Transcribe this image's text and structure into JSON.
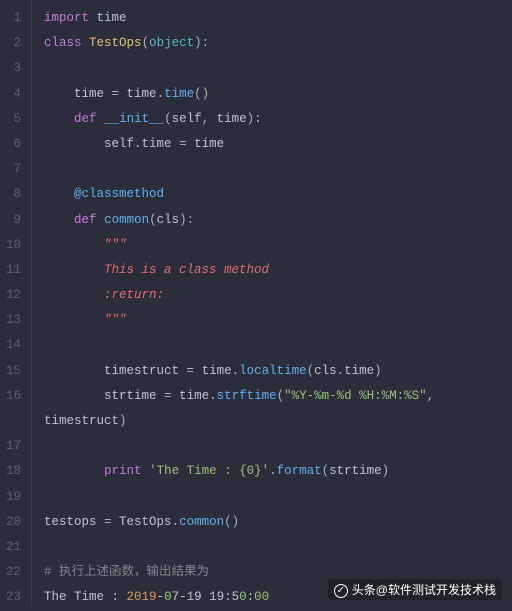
{
  "lineCount": 23,
  "lines": [
    [
      [
        "kw",
        "import"
      ],
      [
        "nm",
        " time"
      ]
    ],
    [
      [
        "kw",
        "class"
      ],
      [
        "nm",
        " "
      ],
      [
        "cls",
        "TestOps"
      ],
      [
        "pun",
        "("
      ],
      [
        "bi",
        "object"
      ],
      [
        "pun",
        "):"
      ]
    ],
    [],
    [
      [
        "nm",
        "    time "
      ],
      [
        "pun",
        "="
      ],
      [
        "nm",
        " time"
      ],
      [
        "pun",
        "."
      ],
      [
        "fn",
        "time"
      ],
      [
        "pun",
        "()"
      ]
    ],
    [
      [
        "nm",
        "    "
      ],
      [
        "kw",
        "def"
      ],
      [
        "nm",
        " "
      ],
      [
        "fn",
        "__init__"
      ],
      [
        "pun",
        "("
      ],
      [
        "nm",
        "self"
      ],
      [
        "pun",
        ", "
      ],
      [
        "nm",
        "time"
      ],
      [
        "pun",
        "):"
      ]
    ],
    [
      [
        "nm",
        "        self"
      ],
      [
        "pun",
        "."
      ],
      [
        "nm",
        "time "
      ],
      [
        "pun",
        "="
      ],
      [
        "nm",
        " time"
      ]
    ],
    [],
    [
      [
        "nm",
        "    "
      ],
      [
        "fn",
        "@classmethod"
      ]
    ],
    [
      [
        "nm",
        "    "
      ],
      [
        "kw",
        "def"
      ],
      [
        "nm",
        " "
      ],
      [
        "fn",
        "common"
      ],
      [
        "pun",
        "("
      ],
      [
        "nm",
        "cls"
      ],
      [
        "pun",
        "):"
      ]
    ],
    [
      [
        "nm",
        "        "
      ],
      [
        "doc",
        "\"\"\""
      ]
    ],
    [
      [
        "nm",
        "        "
      ],
      [
        "doc",
        "This is a class method"
      ]
    ],
    [
      [
        "nm",
        "        "
      ],
      [
        "doc",
        ":return:"
      ]
    ],
    [
      [
        "nm",
        "        "
      ],
      [
        "doc",
        "\"\"\""
      ]
    ],
    [],
    [
      [
        "nm",
        "        timestruct "
      ],
      [
        "pun",
        "="
      ],
      [
        "nm",
        " time"
      ],
      [
        "pun",
        "."
      ],
      [
        "fn",
        "localtime"
      ],
      [
        "pun",
        "("
      ],
      [
        "nm",
        "cls"
      ],
      [
        "pun",
        "."
      ],
      [
        "nm",
        "time"
      ],
      [
        "pun",
        ")"
      ]
    ],
    [
      [
        "nm",
        "        strtime "
      ],
      [
        "pun",
        "="
      ],
      [
        "nm",
        " time"
      ],
      [
        "pun",
        "."
      ],
      [
        "fn",
        "strftime"
      ],
      [
        "pun",
        "("
      ],
      [
        "str",
        "\"%Y-%m-%d %H:%M:%S\""
      ],
      [
        "pun",
        ", "
      ]
    ],
    [
      [
        "nm",
        "timestruct"
      ],
      [
        "pun",
        ")"
      ]
    ],
    [],
    [
      [
        "nm",
        "        "
      ],
      [
        "kw",
        "print"
      ],
      [
        "nm",
        " "
      ],
      [
        "str",
        "'The Time : {0}'"
      ],
      [
        "pun",
        "."
      ],
      [
        "fn",
        "format"
      ],
      [
        "pun",
        "("
      ],
      [
        "nm",
        "strtime"
      ],
      [
        "pun",
        ")"
      ]
    ],
    [],
    [
      [
        "nm",
        "testops "
      ],
      [
        "pun",
        "="
      ],
      [
        "nm",
        " TestOps"
      ],
      [
        "pun",
        "."
      ],
      [
        "fn",
        "common"
      ],
      [
        "pun",
        "()"
      ]
    ],
    [],
    [
      [
        "comcn",
        "# 执行上述函数，输出结果为"
      ]
    ],
    [
      [
        "nm",
        "The Time : "
      ],
      [
        "date-y",
        "2019"
      ],
      [
        "nm",
        "-"
      ],
      [
        "date-g",
        "0"
      ],
      [
        "nm",
        "7-19 19:5"
      ],
      [
        "date-g",
        "0"
      ],
      [
        "nm",
        ":"
      ],
      [
        "date-g",
        "00"
      ]
    ]
  ],
  "gutterWrapAt": 16,
  "watermark": {
    "prefix": "头条",
    "at": "@",
    "name": "软件测试开发技术栈"
  }
}
